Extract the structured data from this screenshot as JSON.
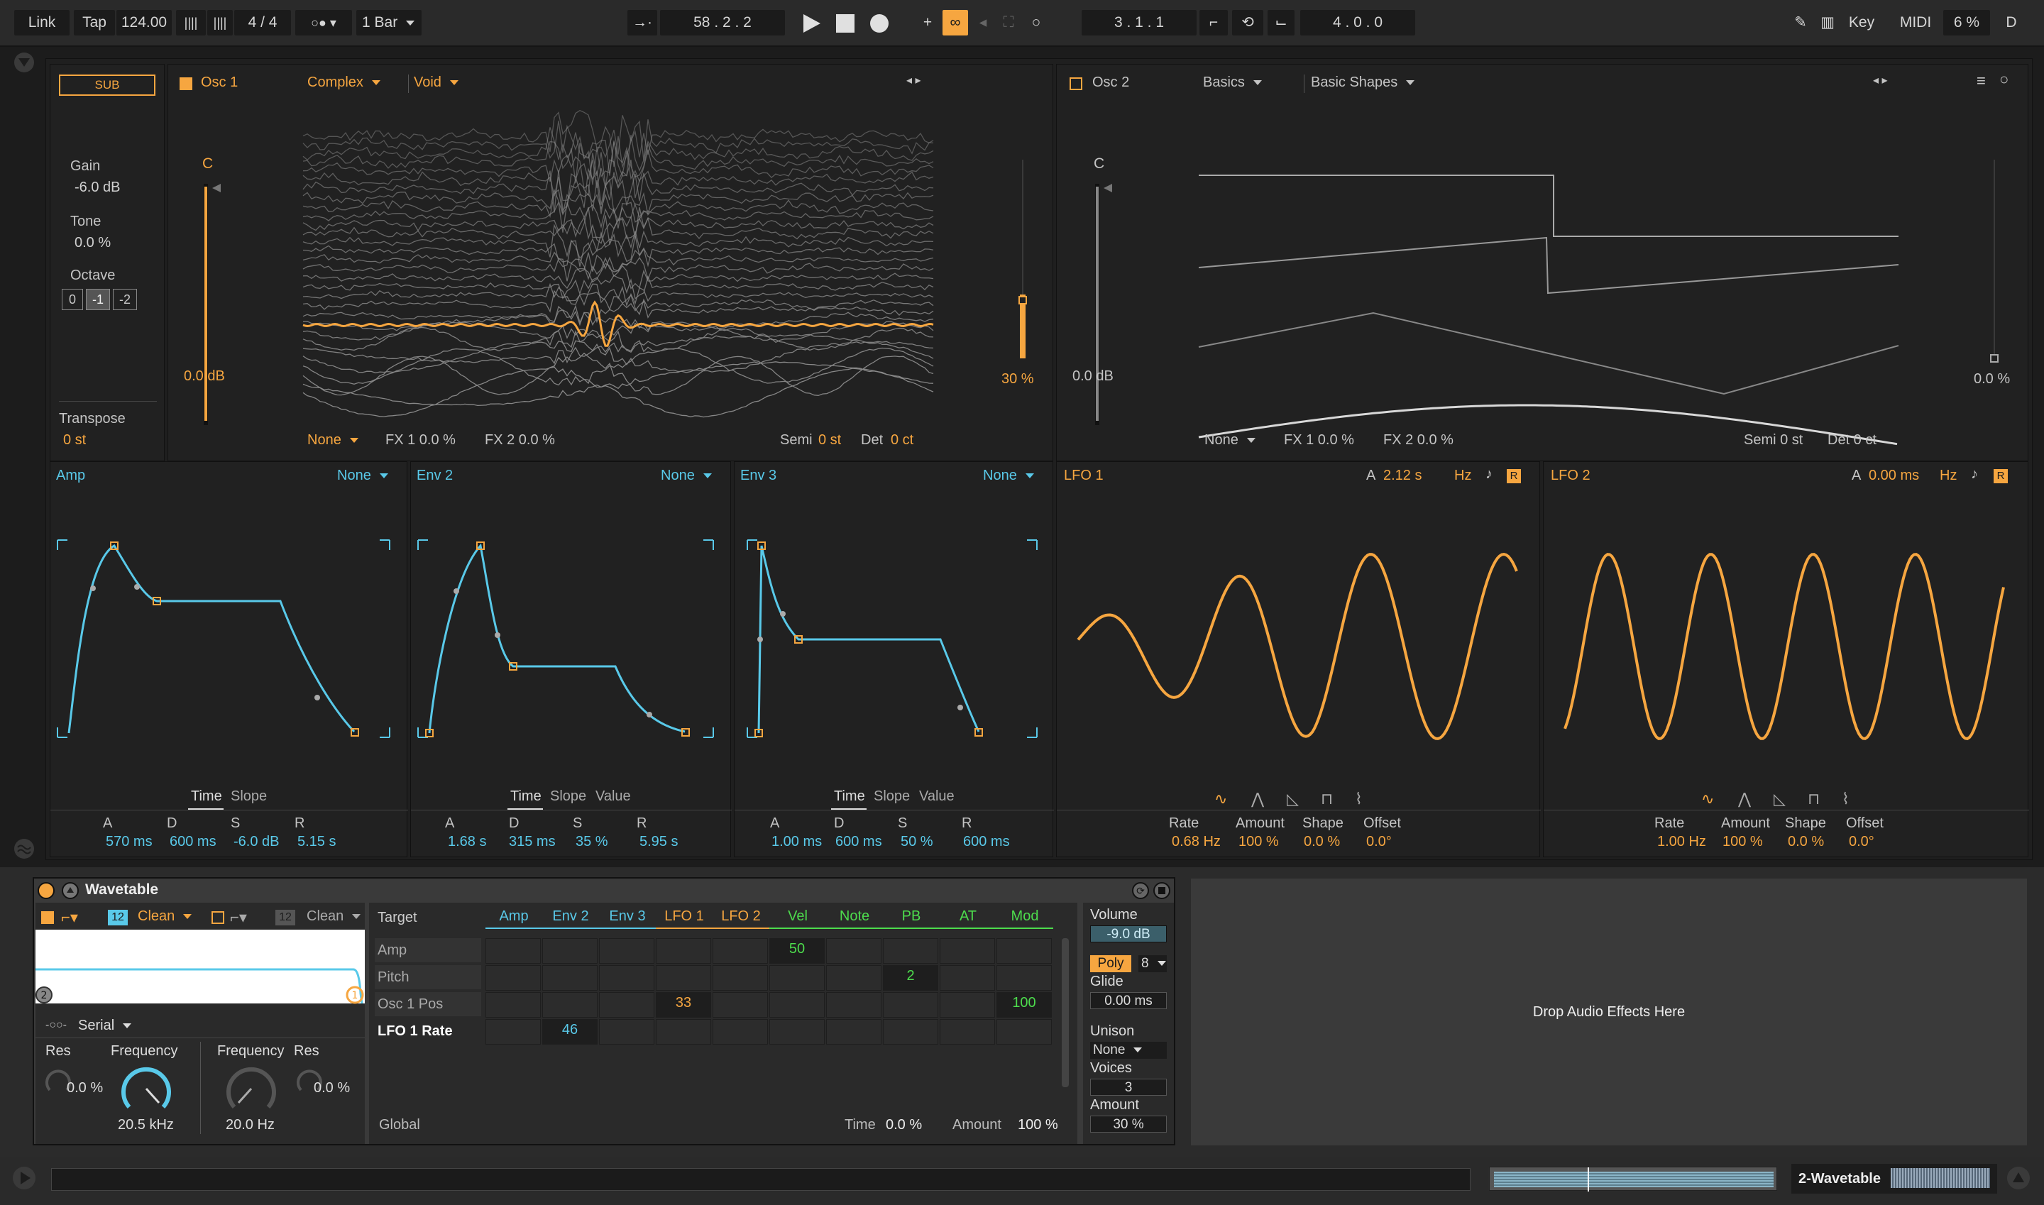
{
  "transport": {
    "link": "Link",
    "tap": "Tap",
    "tempo": "124.00",
    "signature": "4 / 4",
    "quantize": "1 Bar",
    "position": "58 .  2 .  2",
    "loop_start": "3 .  1 .  1",
    "loop_length": "4 .  0 .  0",
    "key": "Key",
    "midi": "MIDI",
    "cpu": "6 %",
    "d": "D"
  },
  "sub": {
    "label": "SUB",
    "gain_label": "Gain",
    "gain": "-6.0 dB",
    "tone_label": "Tone",
    "tone": "0.0 %",
    "octave_label": "Octave",
    "octaves": [
      "0",
      "-1",
      "-2"
    ],
    "transpose_label": "Transpose",
    "transpose": "0 st"
  },
  "osc1": {
    "title": "Osc 1",
    "category": "Complex",
    "wavetable": "Void",
    "note": "C",
    "level": "0.0 dB",
    "position": "30 %",
    "fx_mode": "None",
    "fx1": "FX 1 0.0 %",
    "fx2": "FX 2 0.0 %",
    "semi_label": "Semi",
    "semi": "0 st",
    "det_label": "Det",
    "det": "0 ct"
  },
  "osc2": {
    "title": "Osc 2",
    "category": "Basics",
    "wavetable": "Basic Shapes",
    "note": "C",
    "level": "0.0 dB",
    "position": "0.0 %",
    "fx_mode": "None",
    "fx1": "FX 1 0.0 %",
    "fx2": "FX 2 0.0 %",
    "semi": "Semi 0 st",
    "det": "Det 0 ct"
  },
  "envs": [
    {
      "title": "Amp",
      "target": "None",
      "tabs": [
        "Time",
        "Slope"
      ],
      "labels": [
        "A",
        "D",
        "S",
        "R"
      ],
      "values": [
        "570 ms",
        "600 ms",
        "-6.0 dB",
        "5.15 s"
      ]
    },
    {
      "title": "Env 2",
      "target": "None",
      "tabs": [
        "Time",
        "Slope",
        "Value"
      ],
      "labels": [
        "A",
        "D",
        "S",
        "R"
      ],
      "values": [
        "1.68 s",
        "315 ms",
        "35 %",
        "5.95 s"
      ]
    },
    {
      "title": "Env 3",
      "target": "None",
      "tabs": [
        "Time",
        "Slope",
        "Value"
      ],
      "labels": [
        "A",
        "D",
        "S",
        "R"
      ],
      "values": [
        "1.00 ms",
        "600 ms",
        "50 %",
        "600 ms"
      ]
    }
  ],
  "lfos": [
    {
      "title": "LFO 1",
      "a_label": "A",
      "attack": "2.12 s",
      "unit": "Hz",
      "r": "R",
      "labels": [
        "Rate",
        "Amount",
        "Shape",
        "Offset"
      ],
      "values": [
        "0.68 Hz",
        "100 %",
        "0.0 %",
        "0.0°"
      ]
    },
    {
      "title": "LFO 2",
      "a_label": "A",
      "attack": "0.00 ms",
      "unit": "Hz",
      "r": "R",
      "labels": [
        "Rate",
        "Amount",
        "Shape",
        "Offset"
      ],
      "values": [
        "1.00 Hz",
        "100 %",
        "0.0 %",
        "0.0°"
      ]
    }
  ],
  "device": {
    "name": "Wavetable",
    "filter1": {
      "slope": "12",
      "type": "Clean"
    },
    "filter2": {
      "slope": "12",
      "type": "Clean"
    },
    "routing": "Serial",
    "filter_num": "2",
    "filter_num2": "1",
    "res_label": "Res",
    "res": "0.0 %",
    "freq_label": "Frequency",
    "freq": "20.5 kHz",
    "freq2_label": "Frequency",
    "freq2": "20.0 Hz",
    "res2_label": "Res",
    "res2": "0.0 %"
  },
  "matrix": {
    "target_label": "Target",
    "sources": [
      "Amp",
      "Env 2",
      "Env 3",
      "LFO 1",
      "LFO 2",
      "Vel",
      "Note",
      "PB",
      "AT",
      "Mod"
    ],
    "rows": [
      "Amp",
      "Pitch",
      "Osc 1 Pos",
      "LFO 1 Rate"
    ],
    "cells": [
      {
        "row": 0,
        "col": 5,
        "value": "50"
      },
      {
        "row": 1,
        "col": 7,
        "value": "2"
      },
      {
        "row": 2,
        "col": 3,
        "value": "33"
      },
      {
        "row": 2,
        "col": 9,
        "value": "100"
      },
      {
        "row": 3,
        "col": 1,
        "value": "46"
      }
    ],
    "global_label": "Global",
    "time_label": "Time",
    "time": "0.0 %",
    "amount_label": "Amount",
    "amount": "100 %"
  },
  "voice": {
    "volume_label": "Volume",
    "volume": "-9.0 dB",
    "poly": "Poly",
    "poly_voices": "8",
    "glide_label": "Glide",
    "glide": "0.00 ms",
    "unison_label": "Unison",
    "unison": "None",
    "voices_label": "Voices",
    "voices": "3",
    "amount_label": "Amount",
    "amount": "30 %"
  },
  "drop_zone": "Drop Audio Effects Here",
  "track_name": "2-Wavetable",
  "colors": {
    "accent": "#f6a640",
    "env": "#59c9e9",
    "mod_green": "#4ddc4d"
  }
}
